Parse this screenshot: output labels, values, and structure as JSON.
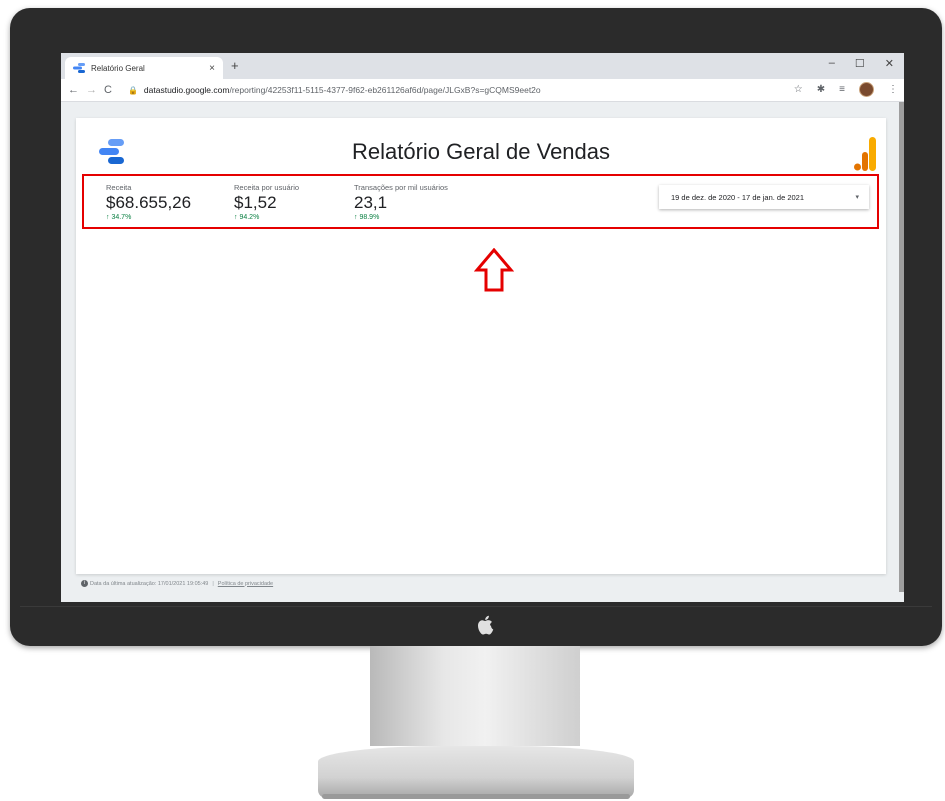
{
  "browser": {
    "tab_title": "Relatório Geral",
    "tab_close": "×",
    "new_tab": "+",
    "window_controls": {
      "minimize": "–",
      "maximize": "☐",
      "close": "✕"
    },
    "nav": {
      "back": "←",
      "forward": "→",
      "reload": "C"
    },
    "url_host": "datastudio.google.com",
    "url_path": "/reporting/42253f11-5115-4377-9f62-eb261126af6d/page/JLGxB?s=gCQMS9eet2o"
  },
  "report": {
    "title": "Relatório Geral de Vendas",
    "scorecards": [
      {
        "label": "Receita",
        "value": "$68.655,26",
        "delta": "34.7%"
      },
      {
        "label": "Receita por usuário",
        "value": "$1,52",
        "delta": "94.2%"
      },
      {
        "label": "Transações por mil usuários",
        "value": "23,1",
        "delta": "98.9%"
      }
    ],
    "date_range": "19 de dez. de 2020 - 17 de jan. de 2021",
    "footer": {
      "last_update": "Data da última atualização: 17/01/2021 19:05:49",
      "privacy": "Política de privacidade"
    }
  },
  "colors": {
    "highlight": "#e50000",
    "delta_up": "#0b8043",
    "ga_orange": "#f9ab00",
    "ga_dark_orange": "#e37400",
    "ds_blue": "#4285f4"
  },
  "icons": [
    "datastudio-logo",
    "google-analytics-logo",
    "lock-icon",
    "star-icon",
    "extension-icon",
    "playlist-icon",
    "up-arrow-annotation",
    "apple-logo",
    "info-icon"
  ]
}
